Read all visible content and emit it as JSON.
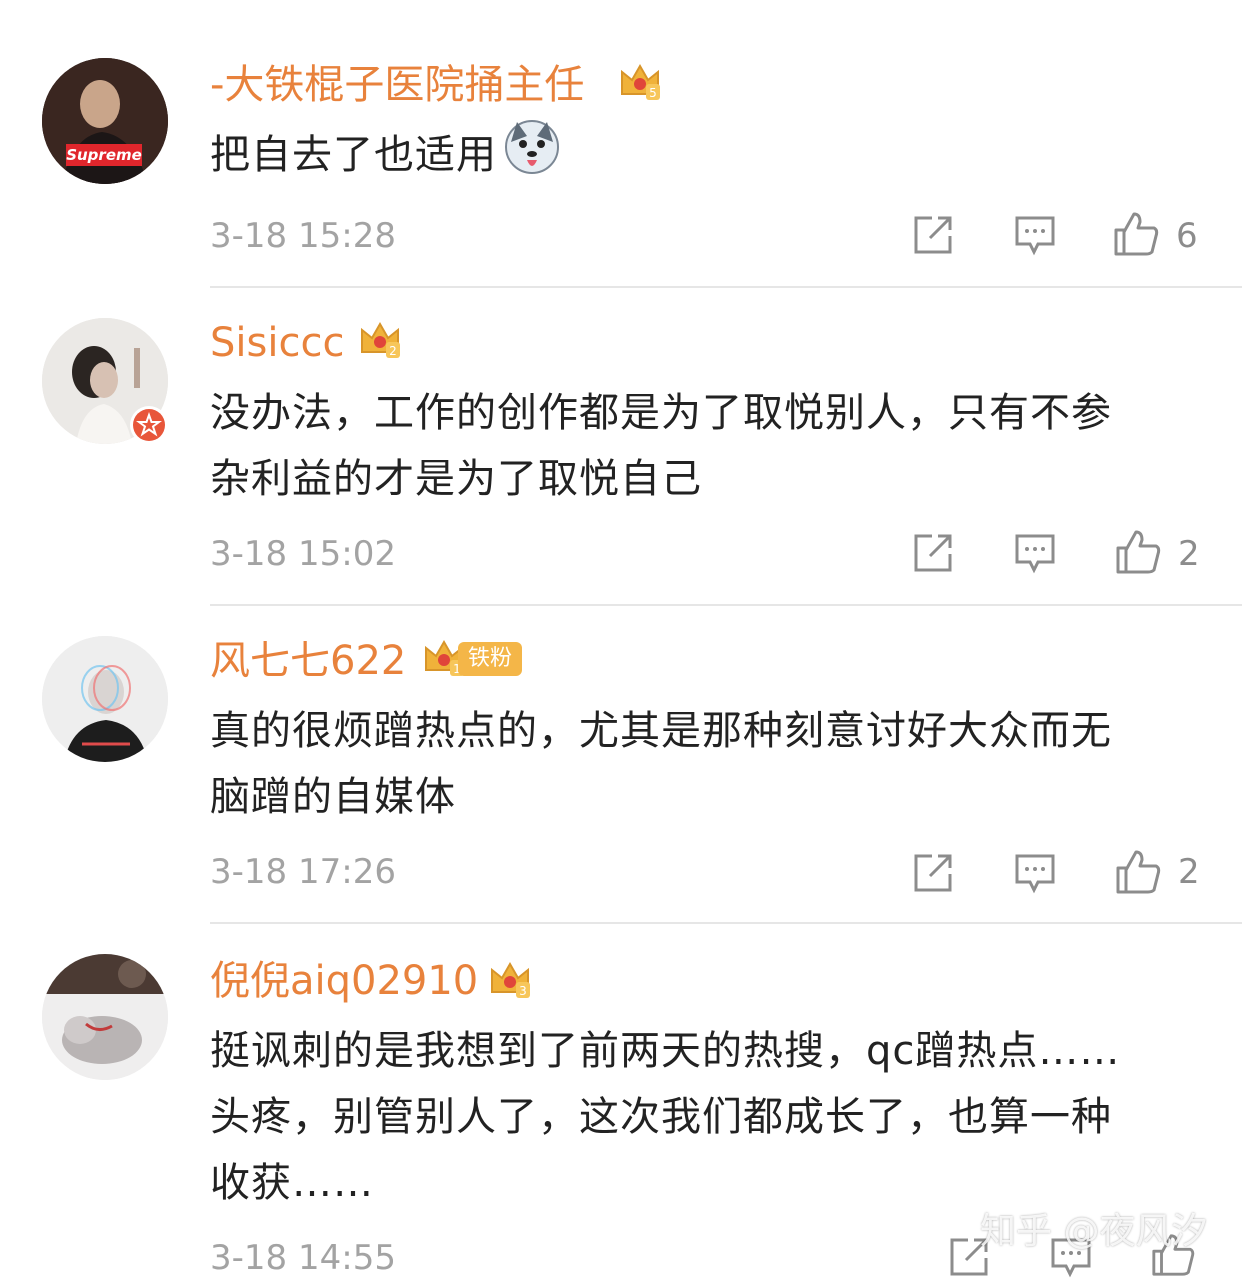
{
  "comments": [
    {
      "user": "-大铁棍子医院捅主任",
      "badge_level": "5",
      "avatar_label": "Supreme",
      "lines": [
        "把自去了也适用"
      ],
      "time": "3-18 15:28",
      "likes": "6"
    },
    {
      "user": "Sisiccc",
      "badge_level": "2",
      "lines": [
        "没办法，工作的创作都是为了取悦别人，只有不参",
        "杂利益的才是为了取悦自己"
      ],
      "time": "3-18 15:02",
      "likes": "2"
    },
    {
      "user": "风七七622",
      "badge_level": "1",
      "fan_badge": "铁粉",
      "lines": [
        "真的很烦蹭热点的，尤其是那种刻意讨好大众而无",
        "脑蹭的自媒体"
      ],
      "time": "3-18 17:26",
      "likes": "2"
    },
    {
      "user": "倪倪aiq02910",
      "badge_level": "3",
      "lines": [
        "挺讽刺的是我想到了前两天的热搜，qc蹭热点……",
        "头疼，别管别人了，这次我们都成长了，也算一种",
        "收获……"
      ],
      "time": "3-18 14:55",
      "likes": ""
    }
  ],
  "watermark": "知乎 @夜风汐",
  "colors": {
    "username": "#e8823c",
    "text": "#222222",
    "meta": "#a3a3a3",
    "crown": "#f0b23a"
  }
}
